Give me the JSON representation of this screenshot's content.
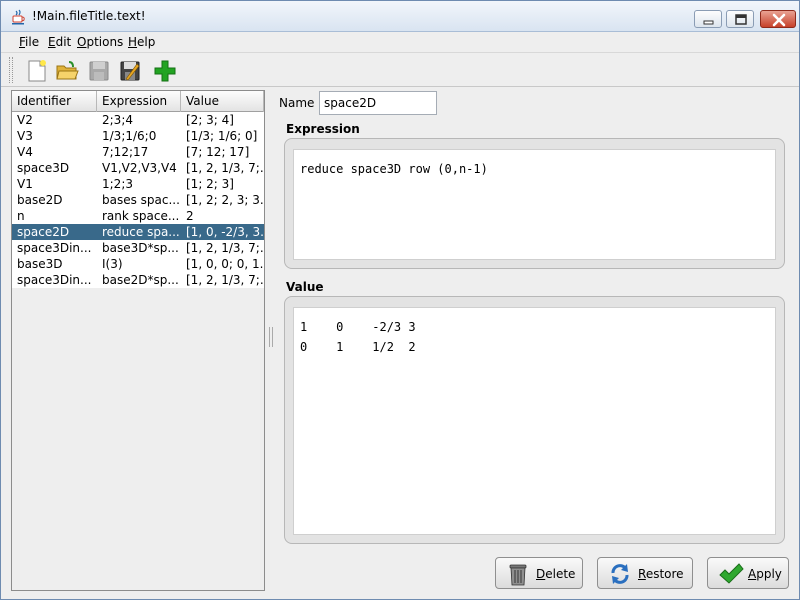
{
  "window": {
    "title": "!Main.fileTitle.text!"
  },
  "menu": {
    "items": [
      "File",
      "Edit",
      "Options",
      "Help"
    ]
  },
  "toolbar": {
    "icons": [
      "new-file-icon",
      "open-folder-icon",
      "save-icon",
      "save-as-icon",
      "add-icon"
    ]
  },
  "table": {
    "headers": [
      "Identifier",
      "Expression",
      "Value"
    ],
    "rows": [
      {
        "id": "V2",
        "expr": "2;3;4",
        "value": "[2; 3; 4]"
      },
      {
        "id": "V3",
        "expr": "1/3;1/6;0",
        "value": "[1/3; 1/6; 0]"
      },
      {
        "id": "V4",
        "expr": "7;12;17",
        "value": "[7; 12; 17]"
      },
      {
        "id": "space3D",
        "expr": "V1,V2,V3,V4",
        "value": "[1, 2, 1/3, 7;..."
      },
      {
        "id": "V1",
        "expr": "1;2;3",
        "value": "[1; 2; 3]"
      },
      {
        "id": "base2D",
        "expr": "bases spac...",
        "value": "[1, 2; 2, 3; 3..."
      },
      {
        "id": "n",
        "expr": "rank space...",
        "value": "2"
      },
      {
        "id": "space2D",
        "expr": "reduce spa...",
        "value": "[1, 0, -2/3, 3..."
      },
      {
        "id": "space3Din...",
        "expr": "base3D*sp...",
        "value": "[1, 2, 1/3, 7;..."
      },
      {
        "id": "base3D",
        "expr": "I(3)",
        "value": "[1, 0, 0; 0, 1..."
      },
      {
        "id": "space3Din...",
        "expr": "base2D*sp...",
        "value": "[1, 2, 1/3, 7;..."
      }
    ],
    "selected_index": 7
  },
  "editor": {
    "name_label": "Name",
    "name_value": "space2D",
    "expression_title": "Expression",
    "expression": "reduce space3D row (0,n-1)",
    "value_title": "Value",
    "value": "1    0    -2/3 3\n0    1    1/2  2"
  },
  "buttons": {
    "delete": "Delete",
    "restore": "Restore",
    "apply": "Apply"
  },
  "colors": {
    "selection": "#39698a",
    "apply_check": "#2fa82f",
    "add_plus": "#22a322"
  }
}
